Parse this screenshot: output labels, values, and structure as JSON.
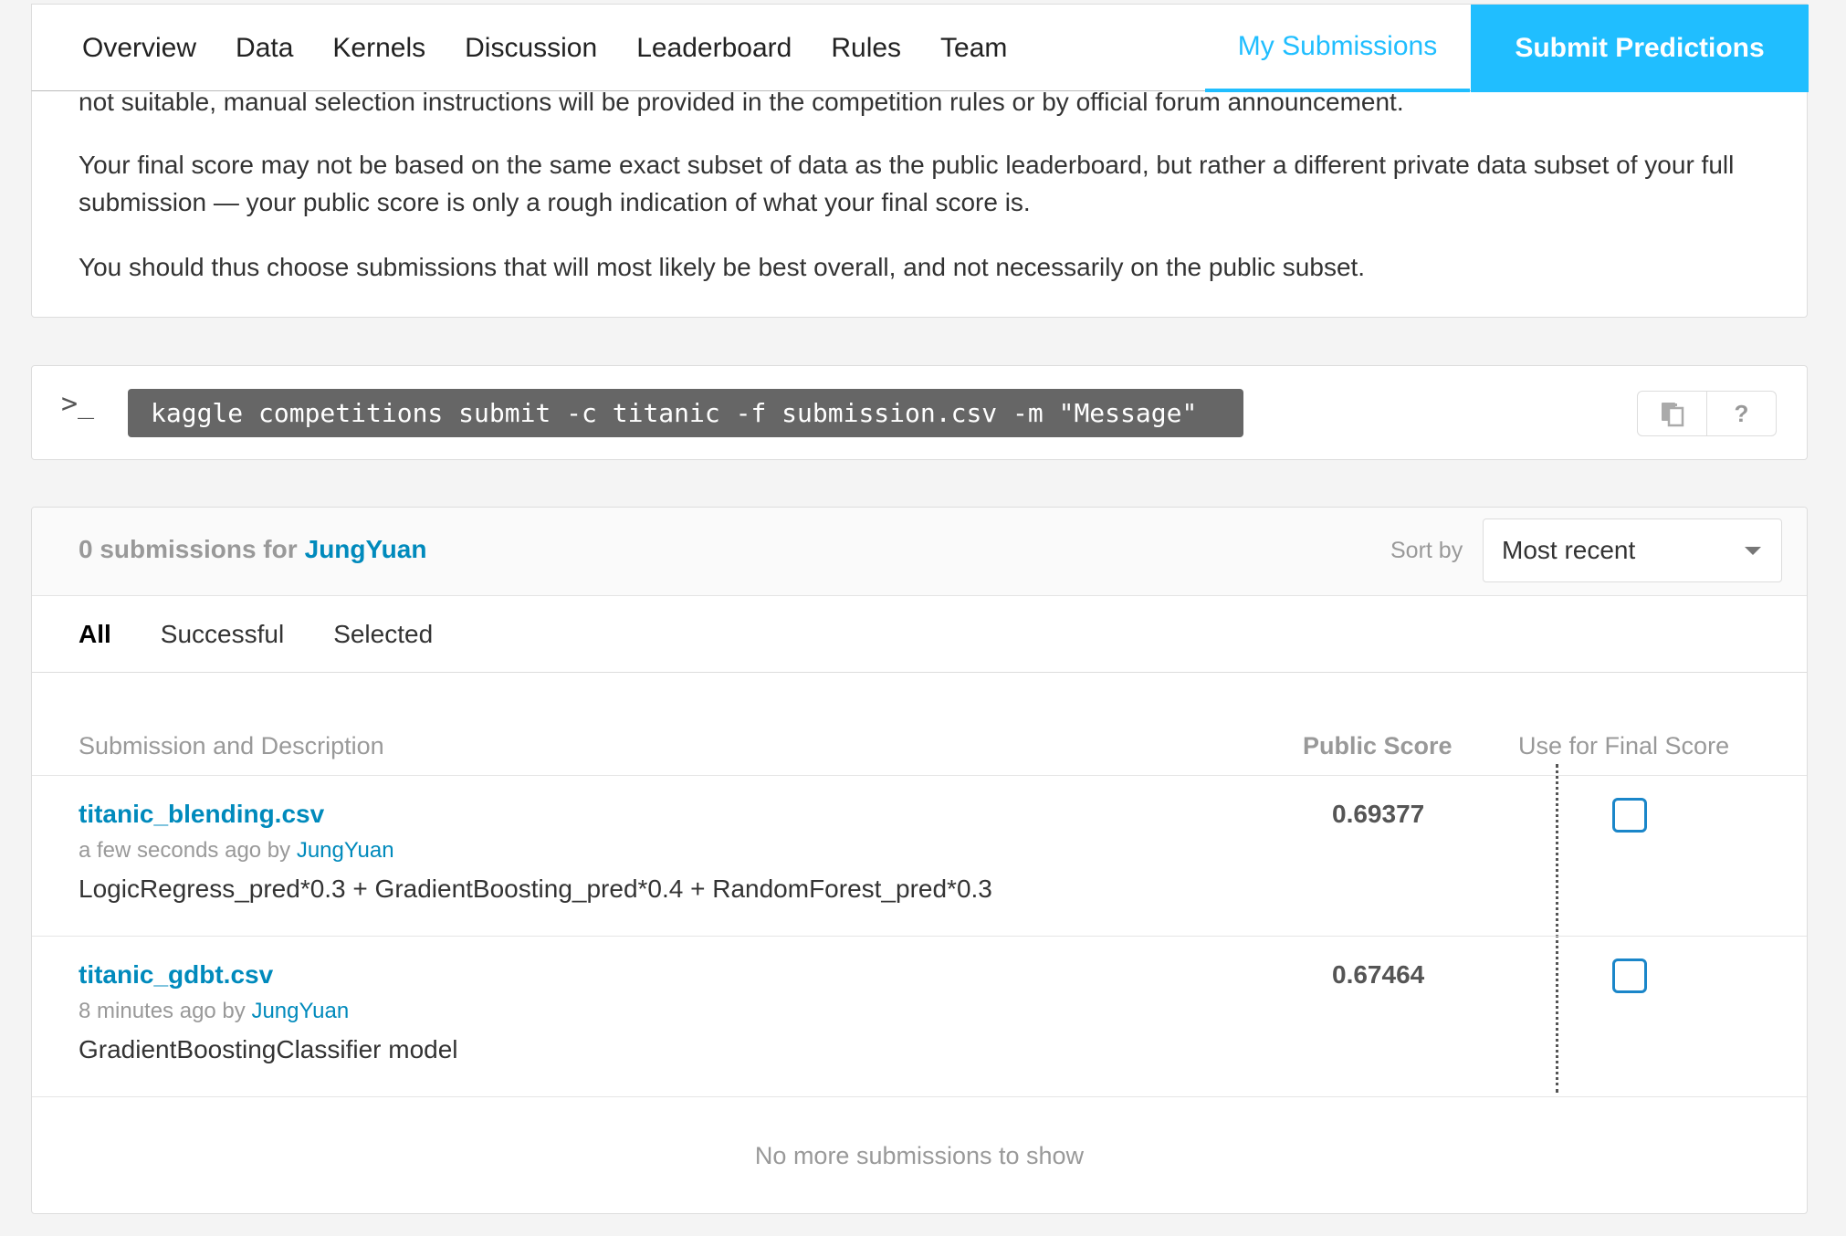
{
  "nav": {
    "tabs": [
      "Overview",
      "Data",
      "Kernels",
      "Discussion",
      "Leaderboard",
      "Rules",
      "Team"
    ],
    "my_submissions": "My Submissions",
    "submit_predictions": "Submit Predictions"
  },
  "info": {
    "p0": "not suitable, manual selection instructions will be provided in the competition rules or by official forum announcement.",
    "p1": "Your final score may not be based on the same exact subset of data as the public leaderboard, but rather a different private data subset of your full submission — your public score is only a rough indication of what your final score is.",
    "p2": "You should thus choose submissions that will most likely be best overall, and not necessarily on the public subset."
  },
  "cli": {
    "prompt": ">_",
    "command": "kaggle competitions submit -c titanic -f submission.csv -m \"Message\"",
    "help": "?"
  },
  "submissions": {
    "count_text": "0 submissions for",
    "user": "JungYuan",
    "sort_label": "Sort by",
    "sort_value": "Most recent",
    "filters": [
      "All",
      "Successful",
      "Selected"
    ],
    "columns": {
      "description": "Submission and Description",
      "score": "Public Score",
      "final": "Use for Final Score"
    },
    "rows": [
      {
        "file": "titanic_blending.csv",
        "time": "a few seconds ago by",
        "by": "JungYuan",
        "description": "LogicRegress_pred*0.3 + GradientBoosting_pred*0.4 + RandomForest_pred*0.3",
        "score": "0.69377"
      },
      {
        "file": "titanic_gdbt.csv",
        "time": "8 minutes ago by",
        "by": "JungYuan",
        "description": "GradientBoostingClassifier model",
        "score": "0.67464"
      }
    ],
    "no_more": "No more submissions to show"
  }
}
